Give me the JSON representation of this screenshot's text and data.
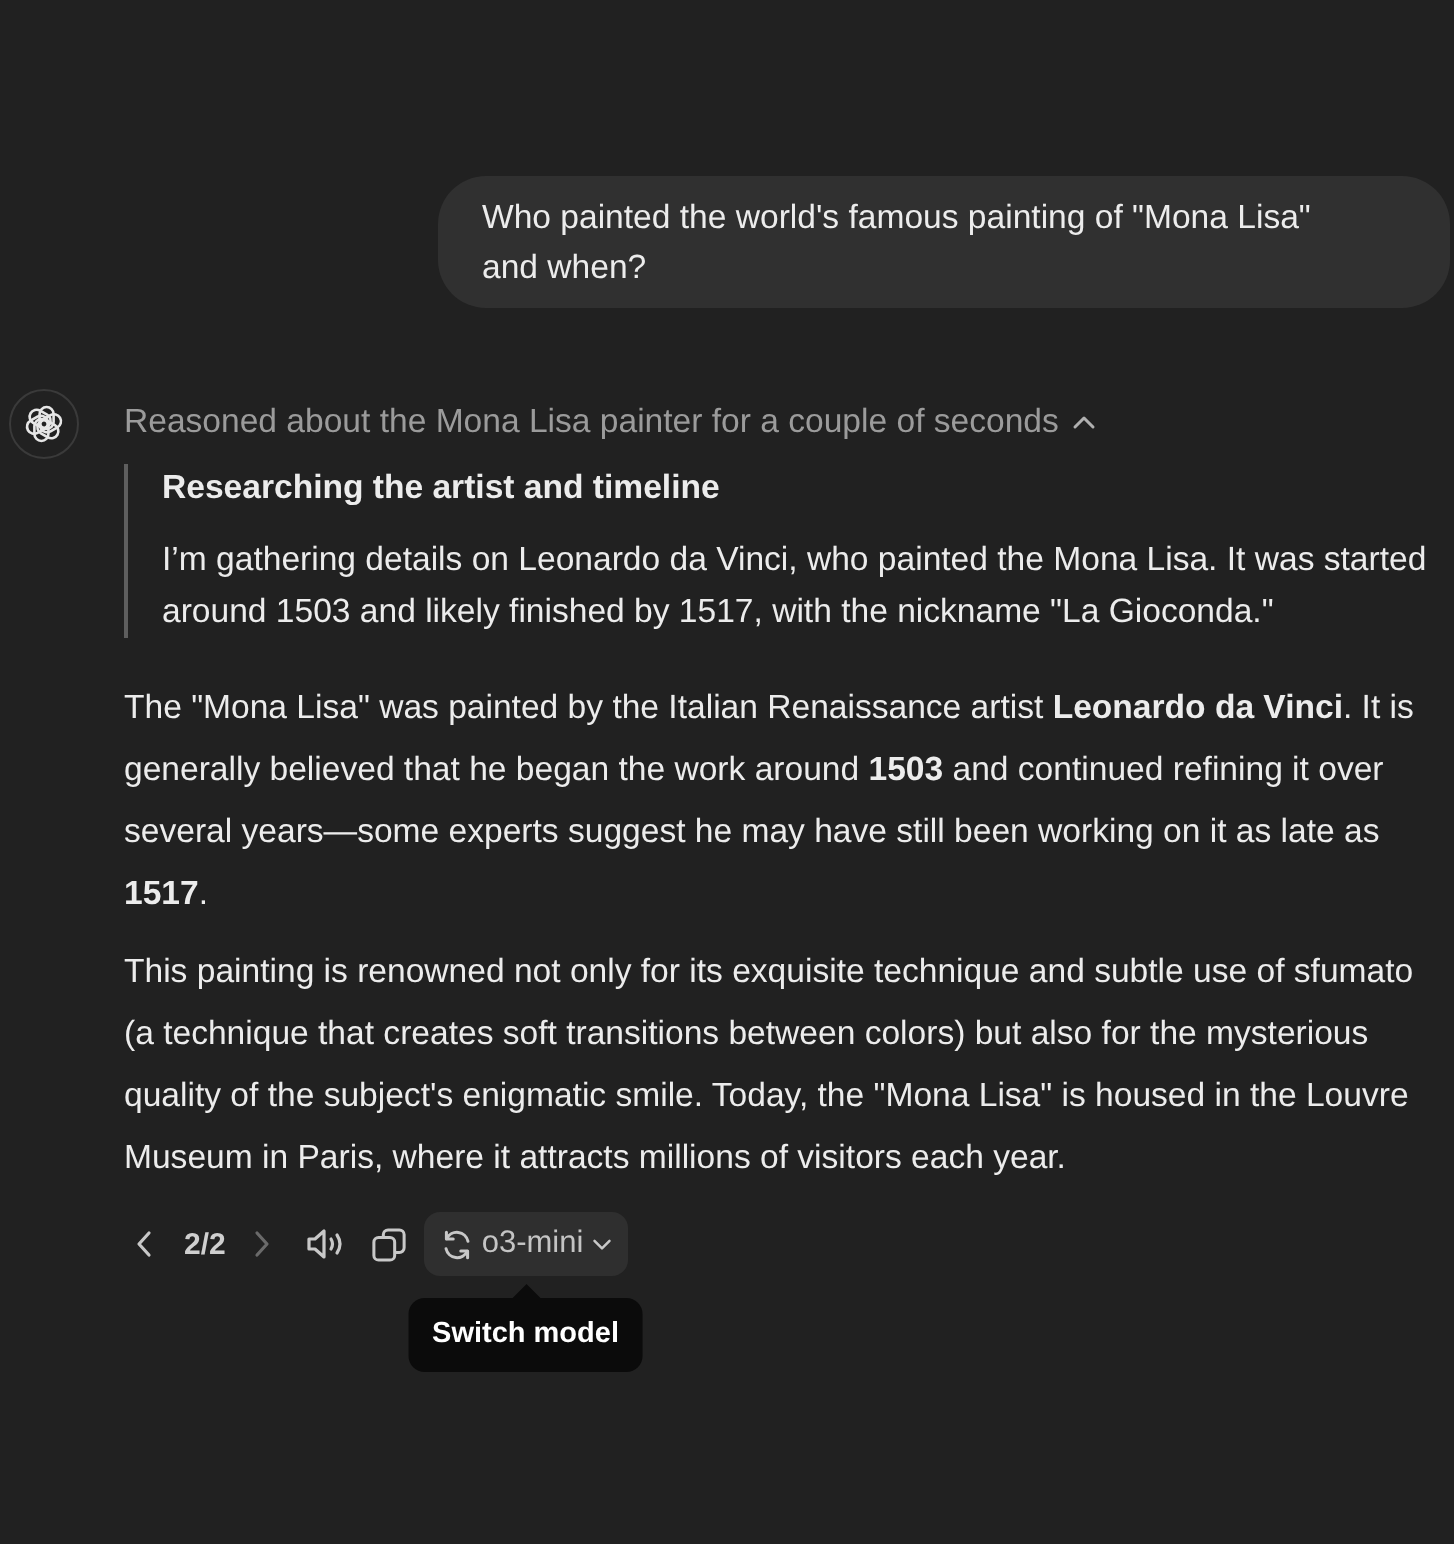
{
  "user_message": {
    "text": "Who painted the world's famous painting of \"Mona Lisa\" and when?"
  },
  "reasoning": {
    "summary": "Reasoned about the Mona Lisa painter for a couple of seconds",
    "expanded": true,
    "steps": [
      {
        "title": "Researching the artist and timeline",
        "text": "I’m gathering details on Leonardo da Vinci, who painted the Mona Lisa. It was started around 1503 and likely finished by 1517, with the nickname \"La Gioconda.\""
      }
    ]
  },
  "answer": {
    "paragraphs": [
      "The \"Mona Lisa\" was painted by the Italian Renaissance artist **Leonardo da Vinci**. It is generally believed that he began the work around **1503** and continued refining it over several years—some experts suggest he may have still been working on it as late as **1517**.",
      "This painting is renowned not only for its exquisite technique and subtle use of sfumato (a technique that creates soft transitions between colors) but also for the mysterious quality of the subject's enigmatic smile. Today, the \"Mona Lisa\" is housed in the Louvre Museum in Paris, where it attracts millions of visitors each year."
    ]
  },
  "actions": {
    "previous": {
      "disabled": false
    },
    "page": "2/2",
    "next": {
      "disabled": true
    },
    "model": "o3-mini",
    "tooltip": "Switch model"
  }
}
